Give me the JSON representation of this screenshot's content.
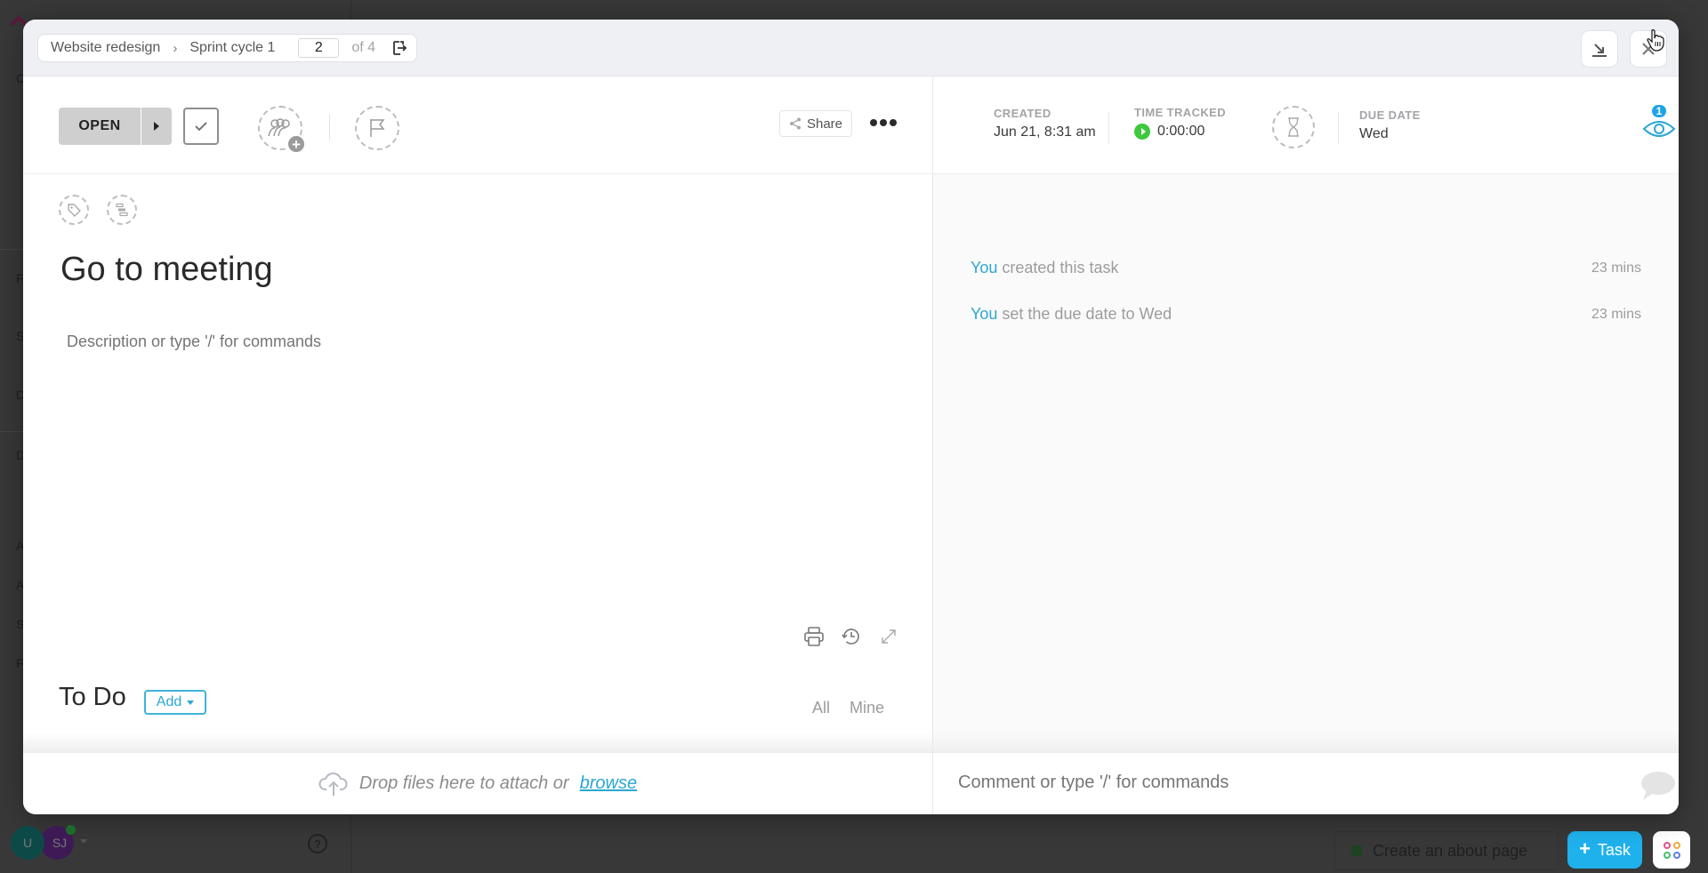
{
  "background": {
    "sidebar_letters": [
      "C",
      "F",
      "S",
      "D",
      "D",
      "A",
      "A",
      "S",
      "F"
    ],
    "user_avatars": [
      {
        "initials": "U",
        "color": "#0c4a48"
      },
      {
        "initials": "SJ",
        "color": "#3d1a56"
      }
    ],
    "tray_task": "Create an about page",
    "task_button_label": "Task",
    "apps_icon_colors": [
      "#e64d8b",
      "#f2a93b",
      "#3ebf6b",
      "#5e7ce8"
    ]
  },
  "modal": {
    "breadcrumb": {
      "items": [
        "Website redesign",
        "Sprint cycle 1"
      ],
      "current_page": "2",
      "page_total_label": "of 4"
    },
    "toolbar": {
      "status_label": "OPEN",
      "share_label": "Share"
    },
    "task": {
      "title": "Go to meeting",
      "description_placeholder": "Description or type '/' for commands"
    },
    "todo": {
      "title": "To Do",
      "add_label": "Add",
      "filters": [
        "All",
        "Mine"
      ]
    },
    "dropzone": {
      "text": "Drop files here to attach or",
      "link": "browse"
    },
    "meta": {
      "created_label": "CREATED",
      "created_value": "Jun 21, 8:31 am",
      "time_tracked_label": "TIME TRACKED",
      "time_tracked_value": "0:00:00",
      "due_date_label": "DUE DATE",
      "due_date_value": "Wed",
      "watchers_count": "1"
    },
    "activity": [
      {
        "actor": "You",
        "action": "created this task",
        "time": "23 mins"
      },
      {
        "actor": "You",
        "action": "set the due date to Wed",
        "time": "23 mins"
      }
    ],
    "comment_placeholder": "Comment or type '/' for commands"
  },
  "colors": {
    "accent": "#2aa7d2",
    "play_green": "#3ec83e",
    "fab_blue": "#1fb1ec",
    "status_gray": "#cfcfcf"
  }
}
